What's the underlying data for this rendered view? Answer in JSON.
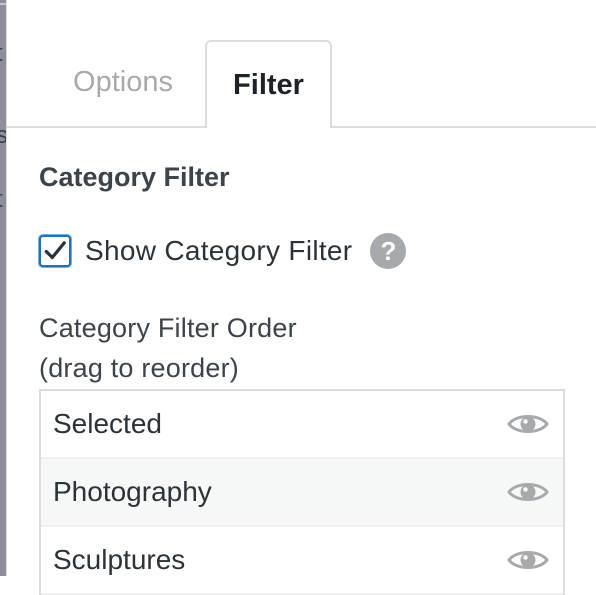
{
  "tabs": [
    {
      "label": "Options",
      "active": false
    },
    {
      "label": "Filter",
      "active": true
    }
  ],
  "section": {
    "title": "Category Filter"
  },
  "show_filter": {
    "label": "Show Category Filter",
    "checked": true,
    "help_glyph": "?"
  },
  "order": {
    "label_line1": "Category Filter Order",
    "label_line2": "(drag to reorder)",
    "items": [
      {
        "label": "Selected",
        "icon": "eye-icon"
      },
      {
        "label": "Photography",
        "icon": "eye-icon"
      },
      {
        "label": "Sculptures",
        "icon": "eye-icon"
      }
    ]
  },
  "colors": {
    "accent": "#2271b1",
    "muted_icon": "#a7aaad"
  }
}
